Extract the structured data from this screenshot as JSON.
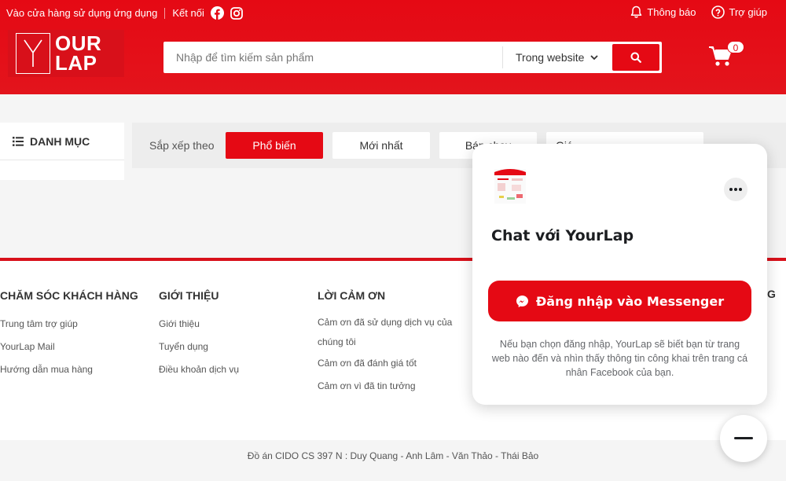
{
  "topbar": {
    "app_link": "Vào cửa hàng sử dụng ứng dụng",
    "connect": "Kết nối",
    "notifications": "Thông báo",
    "help": "Trợ giúp"
  },
  "logo": {
    "line1": "OUR",
    "line2": "LAP"
  },
  "search": {
    "placeholder": "Nhập để tìm kiếm sản phẩm",
    "scope": "Trong website"
  },
  "cart": {
    "count": "0"
  },
  "category": {
    "title": "DANH MỤC"
  },
  "sort": {
    "label": "Sắp xếp theo",
    "options": [
      "Phổ biến",
      "Mới nhất",
      "Bán chạy",
      "Giá"
    ]
  },
  "footer": {
    "columns": [
      {
        "title": "CHĂM SÓC KHÁCH HÀNG",
        "links": [
          "Trung tâm trợ giúp",
          "YourLap Mail",
          "Hướng dẫn mua hàng"
        ]
      },
      {
        "title": "GIỚI THIỆU",
        "links": [
          "Giới thiệu",
          "Tuyển dụng",
          "Điều khoản dịch vụ"
        ]
      },
      {
        "title": "LỜI CẢM ƠN",
        "links": [
          "Cảm ơn đã sử dụng dịch vụ của chúng tôi",
          "Cảm ơn đã đánh giá tốt",
          "Cảm ơn vì đã tin tưởng"
        ]
      }
    ],
    "peek_text": "G",
    "copyright": "Đồ án CIDO CS 397 N : Duy Quang - Anh Lâm - Văn Thảo - Thái Bảo"
  },
  "chat": {
    "title": "Chat với YourLap",
    "login_button": "Đăng nhập vào Messenger",
    "note": "Nếu bạn chọn đăng nhập, YourLap sẽ biết bạn từ trang web nào đến và nhìn thấy thông tin công khai trên trang cá nhân Facebook của bạn."
  },
  "colors": {
    "brand": "#e50914",
    "brand_dark": "#d8101a"
  }
}
